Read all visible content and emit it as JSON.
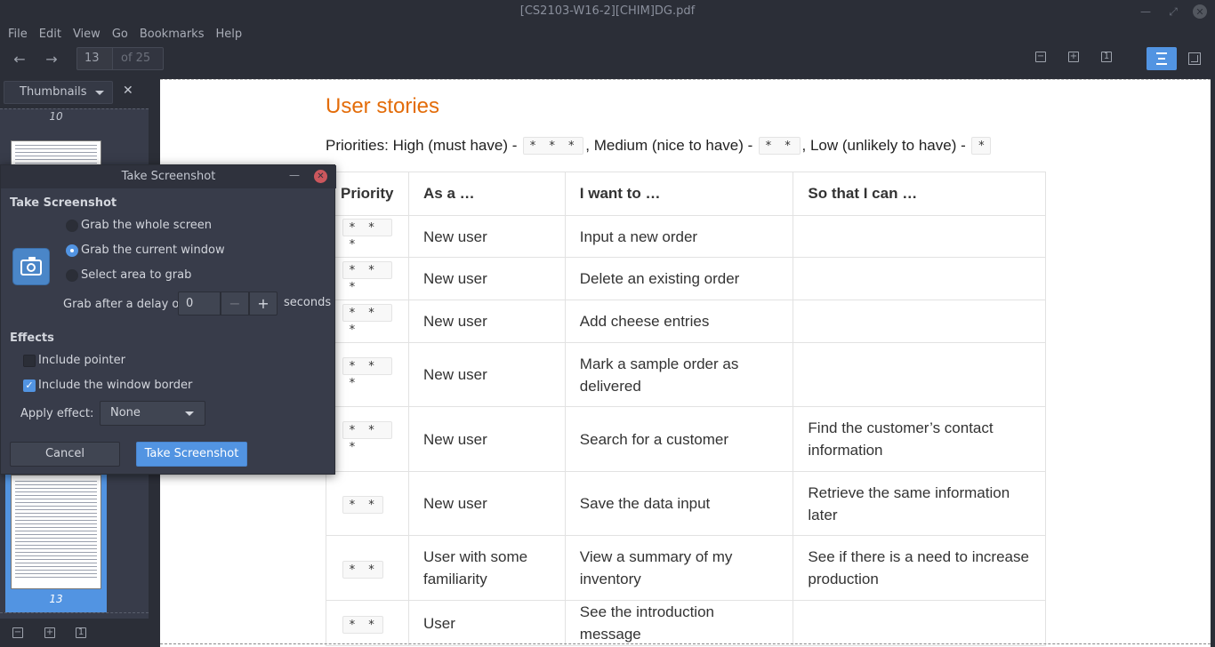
{
  "window": {
    "title": "[CS2103-W16-2][CHIM]DG.pdf"
  },
  "menu": [
    "File",
    "Edit",
    "View",
    "Go",
    "Bookmarks",
    "Help"
  ],
  "toolbar": {
    "current_page": "13",
    "page_count_label": "of 25"
  },
  "sidebar": {
    "mode_label": "Thumbnails",
    "close_glyph": "✕",
    "thumb_top_label": "10",
    "thumb_selected_label": "13"
  },
  "document": {
    "heading": "User stories",
    "priorities": {
      "prefix": "Priorities: High (must have) - ",
      "high_code": "* * *",
      "mid_text": ", Medium (nice to have) - ",
      "medium_code": "* *",
      "low_text": ", Low (unlikely to have) - ",
      "low_code": "*"
    },
    "table": {
      "headers": [
        "Priority",
        "As a …",
        "I want to …",
        "So that I can …"
      ],
      "rows": [
        {
          "priority": "* * *",
          "as_a": "New user",
          "want": "Input a new order",
          "so_that": ""
        },
        {
          "priority": "* * *",
          "as_a": "New user",
          "want": "Delete an existing order",
          "so_that": ""
        },
        {
          "priority": "* * *",
          "as_a": "New user",
          "want": "Add cheese entries",
          "so_that": ""
        },
        {
          "priority": "* * *",
          "as_a": "New user",
          "want": "Mark a sample order as delivered",
          "so_that": ""
        },
        {
          "priority": "* * *",
          "as_a": "New user",
          "want": "Search for a customer",
          "so_that": "Find the customer’s contact information"
        },
        {
          "priority": "* *",
          "as_a": "New user",
          "want": "Save the data input",
          "so_that": "Retrieve the same information later"
        },
        {
          "priority": "* *",
          "as_a": "User with some familiarity",
          "want": "View a summary of my inventory",
          "so_that": "See if there is a need to increase production"
        },
        {
          "priority": "* *",
          "as_a": "User",
          "want": "See the introduction message",
          "so_that": ""
        }
      ]
    }
  },
  "dialog": {
    "title": "Take Screenshot",
    "section_title": "Take Screenshot",
    "options": [
      {
        "label": "Grab the whole screen",
        "selected": false
      },
      {
        "label": "Grab the current window",
        "selected": true
      },
      {
        "label": "Select area to grab",
        "selected": false
      }
    ],
    "delay_label": "Grab after a delay of",
    "delay_value": "0",
    "delay_unit": "seconds",
    "effects_title": "Effects",
    "include_pointer": {
      "label": "Include pointer",
      "checked": false
    },
    "include_border": {
      "label": "Include the window border",
      "checked": true
    },
    "apply_effect_label": "Apply effect:",
    "apply_effect_value": "None",
    "cancel_label": "Cancel",
    "take_label": "Take Screenshot"
  }
}
